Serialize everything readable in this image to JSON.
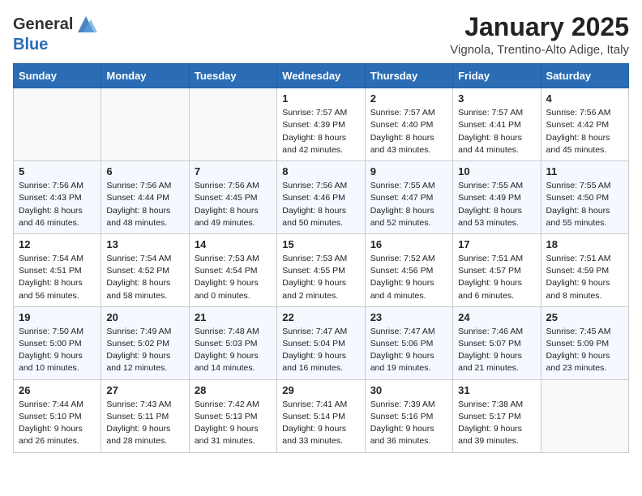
{
  "header": {
    "logo_general": "General",
    "logo_blue": "Blue",
    "month": "January 2025",
    "location": "Vignola, Trentino-Alto Adige, Italy"
  },
  "weekdays": [
    "Sunday",
    "Monday",
    "Tuesday",
    "Wednesday",
    "Thursday",
    "Friday",
    "Saturday"
  ],
  "weeks": [
    [
      {
        "day": "",
        "empty": true
      },
      {
        "day": "",
        "empty": true
      },
      {
        "day": "",
        "empty": true
      },
      {
        "day": "1",
        "sunrise": "7:57 AM",
        "sunset": "4:39 PM",
        "daylight": "8 hours and 42 minutes."
      },
      {
        "day": "2",
        "sunrise": "7:57 AM",
        "sunset": "4:40 PM",
        "daylight": "8 hours and 43 minutes."
      },
      {
        "day": "3",
        "sunrise": "7:57 AM",
        "sunset": "4:41 PM",
        "daylight": "8 hours and 44 minutes."
      },
      {
        "day": "4",
        "sunrise": "7:56 AM",
        "sunset": "4:42 PM",
        "daylight": "8 hours and 45 minutes."
      }
    ],
    [
      {
        "day": "5",
        "sunrise": "7:56 AM",
        "sunset": "4:43 PM",
        "daylight": "8 hours and 46 minutes."
      },
      {
        "day": "6",
        "sunrise": "7:56 AM",
        "sunset": "4:44 PM",
        "daylight": "8 hours and 48 minutes."
      },
      {
        "day": "7",
        "sunrise": "7:56 AM",
        "sunset": "4:45 PM",
        "daylight": "8 hours and 49 minutes."
      },
      {
        "day": "8",
        "sunrise": "7:56 AM",
        "sunset": "4:46 PM",
        "daylight": "8 hours and 50 minutes."
      },
      {
        "day": "9",
        "sunrise": "7:55 AM",
        "sunset": "4:47 PM",
        "daylight": "8 hours and 52 minutes."
      },
      {
        "day": "10",
        "sunrise": "7:55 AM",
        "sunset": "4:49 PM",
        "daylight": "8 hours and 53 minutes."
      },
      {
        "day": "11",
        "sunrise": "7:55 AM",
        "sunset": "4:50 PM",
        "daylight": "8 hours and 55 minutes."
      }
    ],
    [
      {
        "day": "12",
        "sunrise": "7:54 AM",
        "sunset": "4:51 PM",
        "daylight": "8 hours and 56 minutes."
      },
      {
        "day": "13",
        "sunrise": "7:54 AM",
        "sunset": "4:52 PM",
        "daylight": "8 hours and 58 minutes."
      },
      {
        "day": "14",
        "sunrise": "7:53 AM",
        "sunset": "4:54 PM",
        "daylight": "9 hours and 0 minutes."
      },
      {
        "day": "15",
        "sunrise": "7:53 AM",
        "sunset": "4:55 PM",
        "daylight": "9 hours and 2 minutes."
      },
      {
        "day": "16",
        "sunrise": "7:52 AM",
        "sunset": "4:56 PM",
        "daylight": "9 hours and 4 minutes."
      },
      {
        "day": "17",
        "sunrise": "7:51 AM",
        "sunset": "4:57 PM",
        "daylight": "9 hours and 6 minutes."
      },
      {
        "day": "18",
        "sunrise": "7:51 AM",
        "sunset": "4:59 PM",
        "daylight": "9 hours and 8 minutes."
      }
    ],
    [
      {
        "day": "19",
        "sunrise": "7:50 AM",
        "sunset": "5:00 PM",
        "daylight": "9 hours and 10 minutes."
      },
      {
        "day": "20",
        "sunrise": "7:49 AM",
        "sunset": "5:02 PM",
        "daylight": "9 hours and 12 minutes."
      },
      {
        "day": "21",
        "sunrise": "7:48 AM",
        "sunset": "5:03 PM",
        "daylight": "9 hours and 14 minutes."
      },
      {
        "day": "22",
        "sunrise": "7:47 AM",
        "sunset": "5:04 PM",
        "daylight": "9 hours and 16 minutes."
      },
      {
        "day": "23",
        "sunrise": "7:47 AM",
        "sunset": "5:06 PM",
        "daylight": "9 hours and 19 minutes."
      },
      {
        "day": "24",
        "sunrise": "7:46 AM",
        "sunset": "5:07 PM",
        "daylight": "9 hours and 21 minutes."
      },
      {
        "day": "25",
        "sunrise": "7:45 AM",
        "sunset": "5:09 PM",
        "daylight": "9 hours and 23 minutes."
      }
    ],
    [
      {
        "day": "26",
        "sunrise": "7:44 AM",
        "sunset": "5:10 PM",
        "daylight": "9 hours and 26 minutes."
      },
      {
        "day": "27",
        "sunrise": "7:43 AM",
        "sunset": "5:11 PM",
        "daylight": "9 hours and 28 minutes."
      },
      {
        "day": "28",
        "sunrise": "7:42 AM",
        "sunset": "5:13 PM",
        "daylight": "9 hours and 31 minutes."
      },
      {
        "day": "29",
        "sunrise": "7:41 AM",
        "sunset": "5:14 PM",
        "daylight": "9 hours and 33 minutes."
      },
      {
        "day": "30",
        "sunrise": "7:39 AM",
        "sunset": "5:16 PM",
        "daylight": "9 hours and 36 minutes."
      },
      {
        "day": "31",
        "sunrise": "7:38 AM",
        "sunset": "5:17 PM",
        "daylight": "9 hours and 39 minutes."
      },
      {
        "day": "",
        "empty": true
      }
    ]
  ]
}
